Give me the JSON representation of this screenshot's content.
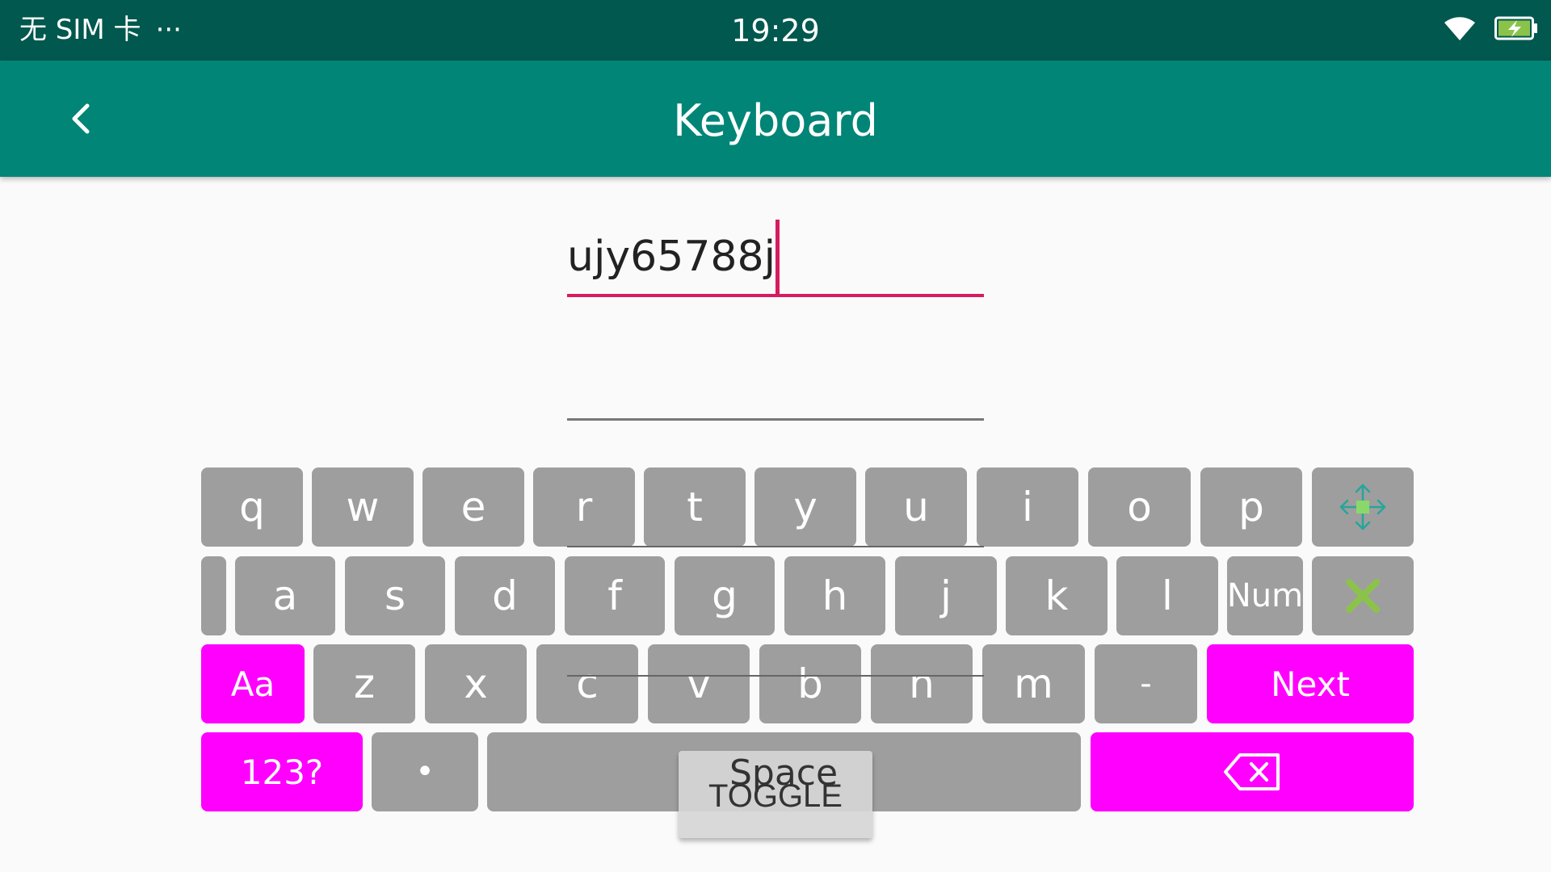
{
  "status_bar": {
    "carrier": "无 SIM 卡",
    "more": "···",
    "time": "19:29",
    "icons": [
      "wifi-icon",
      "battery-charging-icon"
    ]
  },
  "app_bar": {
    "title": "Keyboard",
    "back_icon": "chevron-left-icon"
  },
  "inputs": {
    "first_value": "ujy65788j",
    "second_value": ""
  },
  "keyboard": {
    "row1": [
      "q",
      "w",
      "e",
      "r",
      "t",
      "y",
      "u",
      "i",
      "o",
      "p"
    ],
    "row1_extra_icon": "move-arrows-icon",
    "row2": [
      "a",
      "s",
      "d",
      "f",
      "g",
      "h",
      "j",
      "k",
      "l"
    ],
    "num_label": "Num",
    "close_icon": "close-x-icon",
    "shift_label": "Aa",
    "row3": [
      "z",
      "x",
      "c",
      "v",
      "b",
      "n",
      "m",
      "-"
    ],
    "next_label": "Next",
    "symbols_label": "123?",
    "dot_label": "•",
    "space_label": "Space",
    "backspace_icon": "backspace-icon"
  },
  "toggle_label": "TOGGLE",
  "colors": {
    "status_bar": "#00584e",
    "app_bar": "#008577",
    "accent": "#d81b60",
    "key": "#9e9e9e",
    "special_key": "#ff00ff"
  }
}
